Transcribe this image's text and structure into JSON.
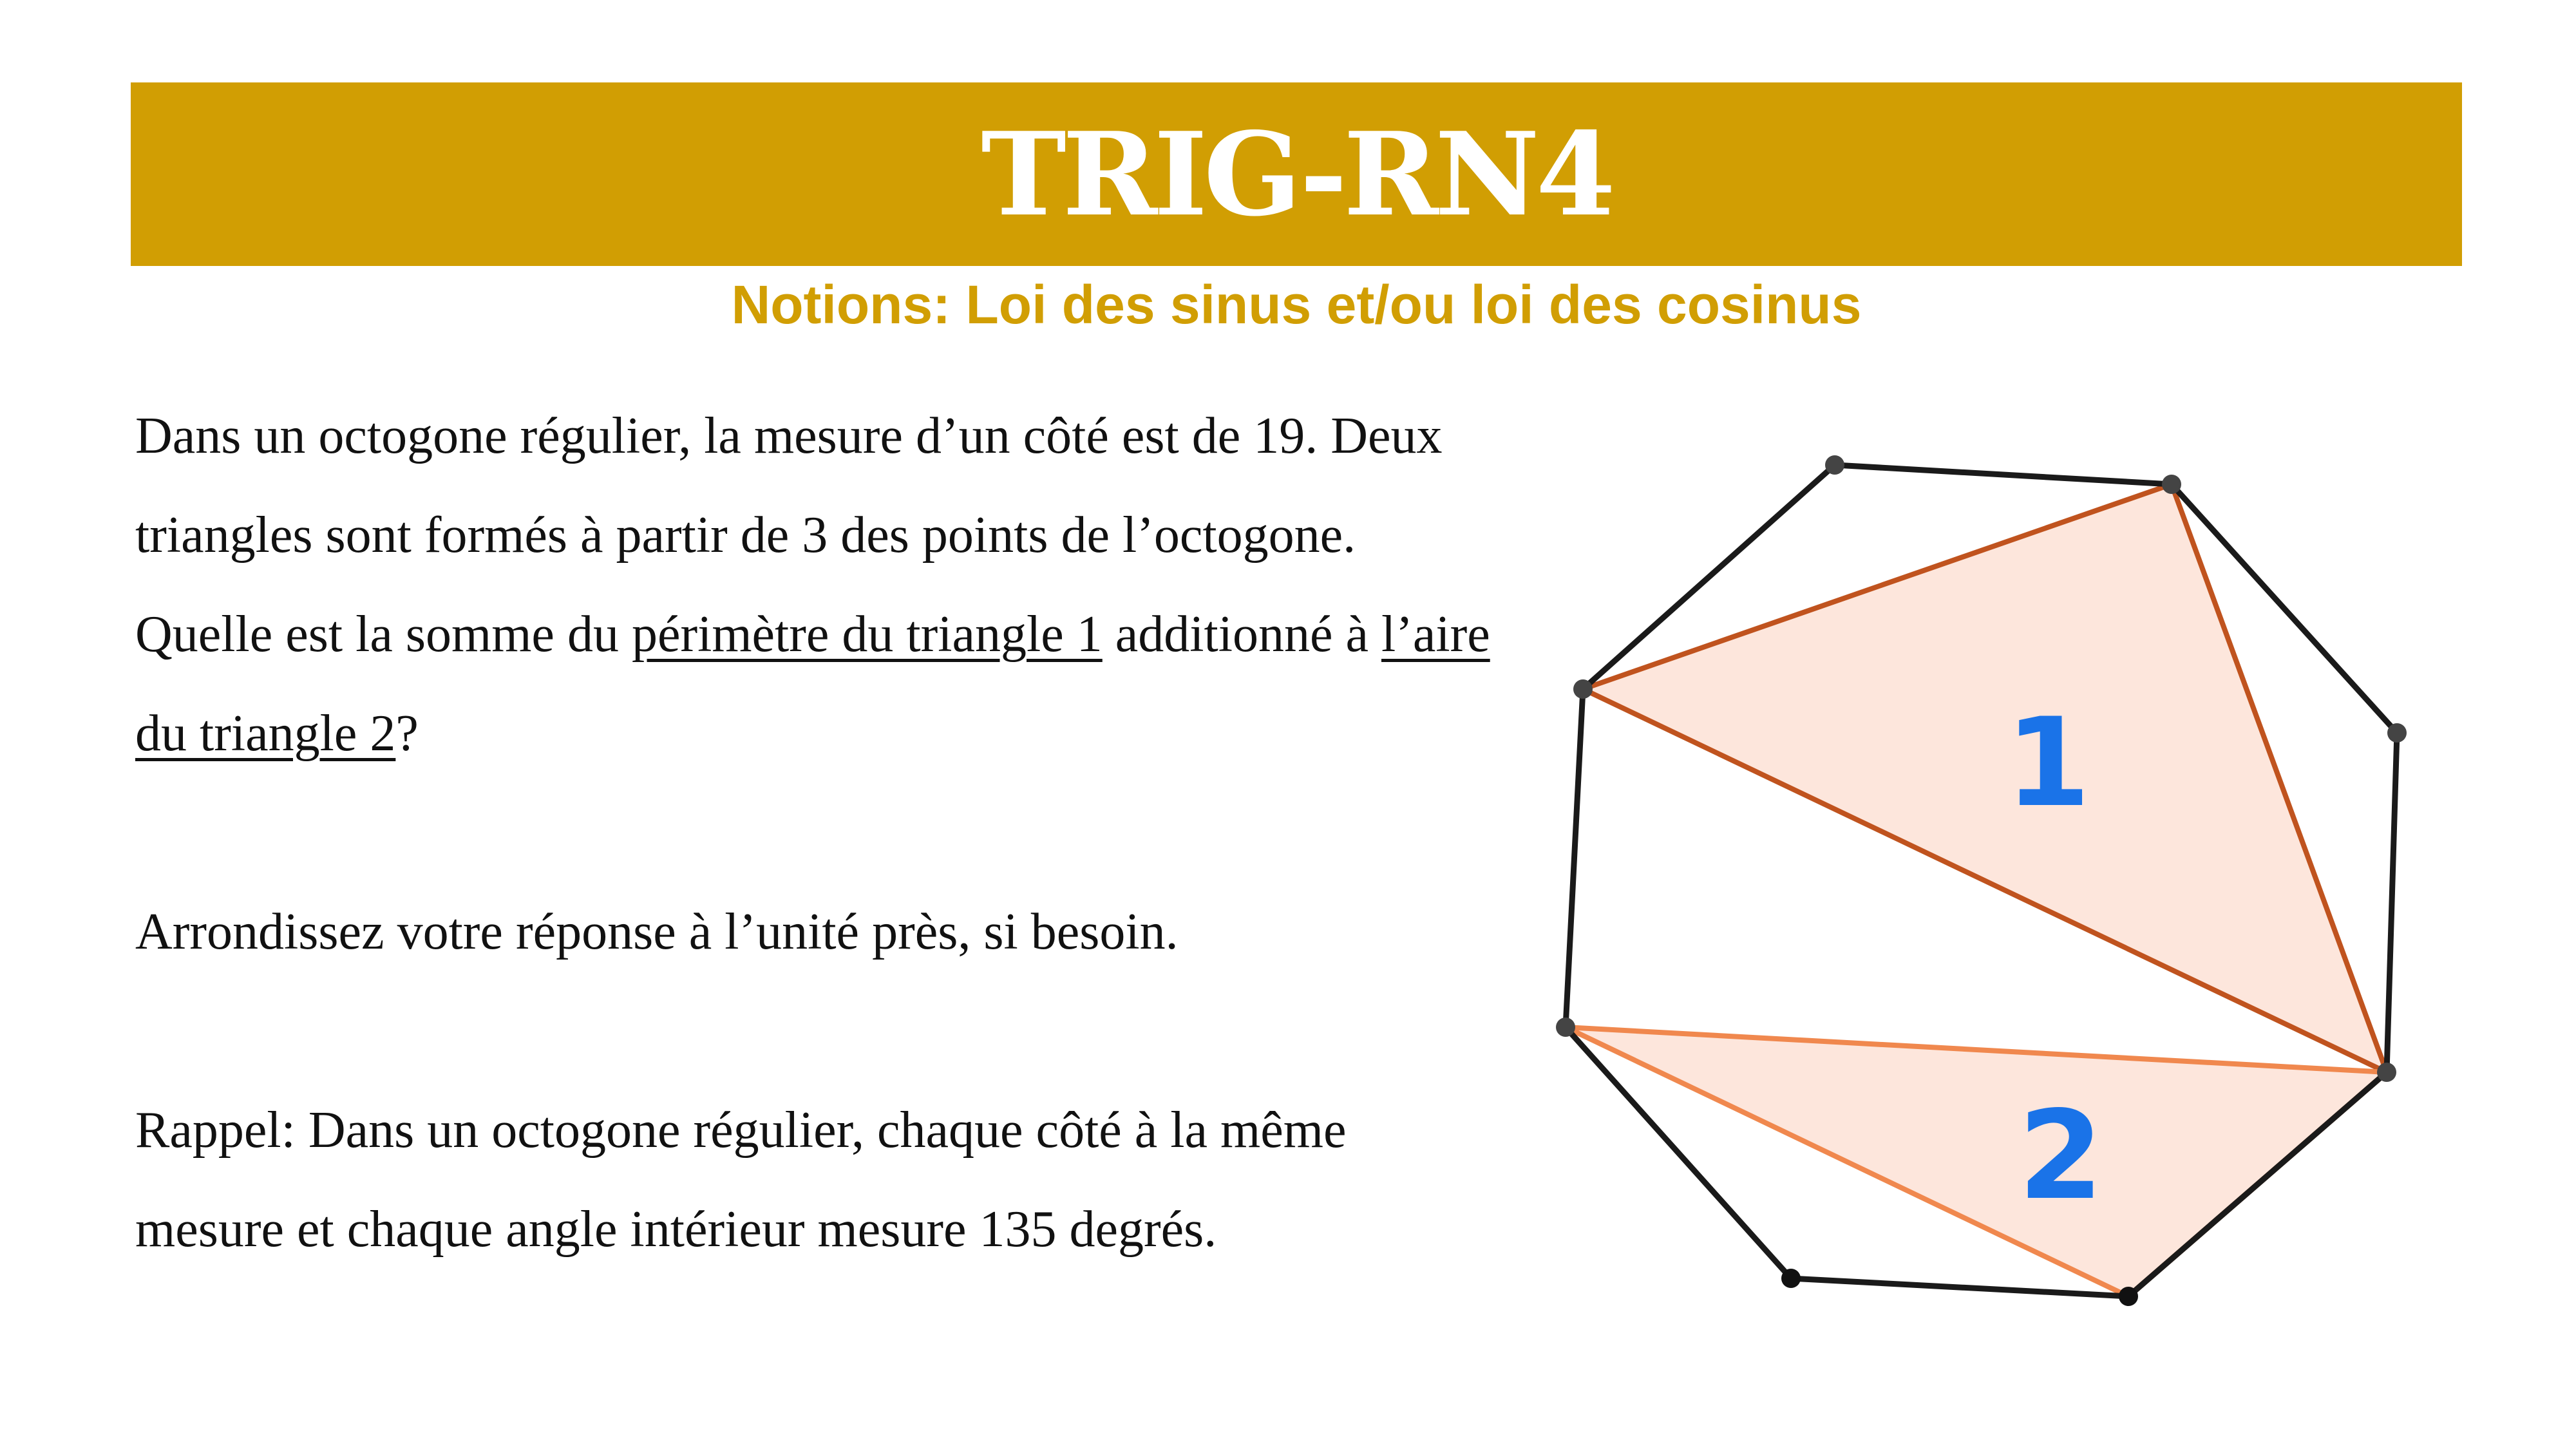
{
  "header": {
    "title": "TRIG-RN4",
    "subtitle": "Notions: Loi des sinus et/ou loi des cosinus",
    "banner_color": "#d19e03"
  },
  "problem": {
    "p1_part1": "Dans un octogone régulier, la mesure d’un côté est de 19. Deux triangles sont formés à partir de 3 des points de l’octogone. Quelle est la somme du ",
    "p1_link1": "périmètre du triangle 1",
    "p1_part2": " additionné à ",
    "p1_link2": "l’aire du triangle 2",
    "p1_part3": "?",
    "p2": "Arrondissez votre réponse à l’unité près, si besoin.",
    "p3": "Rappel: Dans un octogone régulier, chaque côté à la même mesure et chaque angle intérieur mesure 135 degrés."
  },
  "figure": {
    "triangle_1_label": "1",
    "triangle_2_label": "2",
    "label_color": "#1a73e8",
    "triangle_fill": "#fde6dc",
    "triangle_1_stroke": "#c0531e",
    "triangle_2_stroke": "#f0884e",
    "octagon_stroke": "#1a1a1a"
  }
}
